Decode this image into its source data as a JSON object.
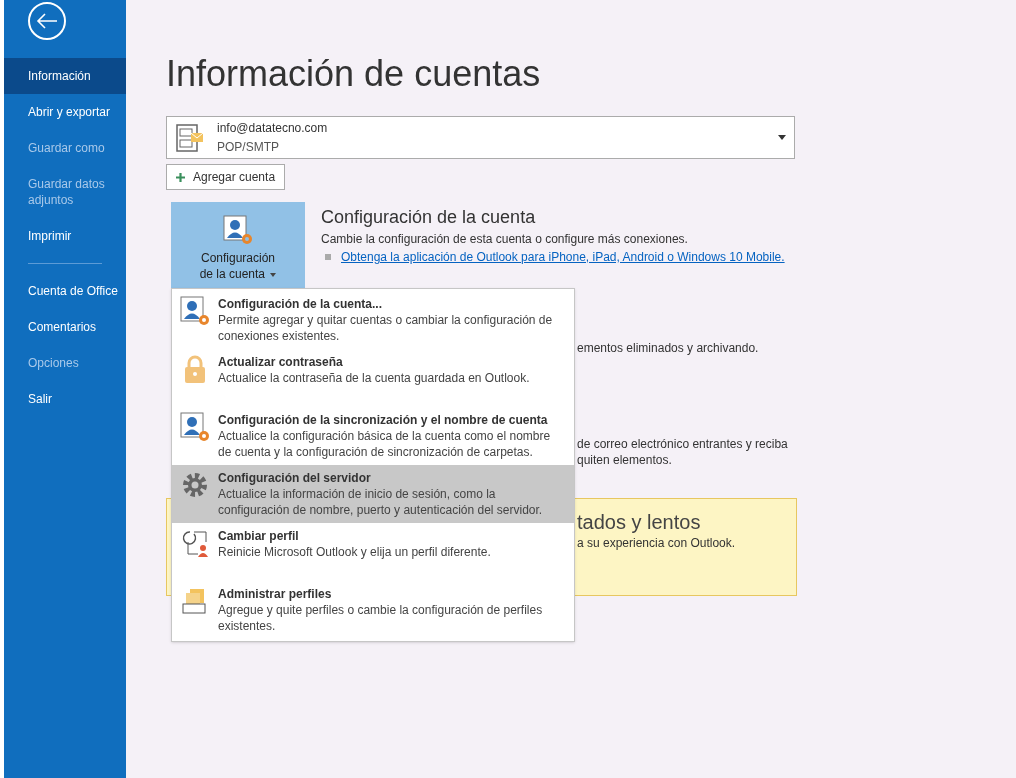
{
  "sidebar": {
    "items": [
      {
        "label": "Información",
        "selected": true,
        "disabled": false,
        "separator_after": false
      },
      {
        "label": "Abrir y exportar",
        "selected": false,
        "disabled": false,
        "separator_after": false
      },
      {
        "label": "Guardar como",
        "selected": false,
        "disabled": true,
        "separator_after": false
      },
      {
        "label": "Guardar datos adjuntos",
        "selected": false,
        "disabled": true,
        "separator_after": false
      },
      {
        "label": "Imprimir",
        "selected": false,
        "disabled": false,
        "separator_after": true
      },
      {
        "label": "Cuenta de Office",
        "selected": false,
        "disabled": false,
        "separator_after": false
      },
      {
        "label": "Comentarios",
        "selected": false,
        "disabled": false,
        "separator_after": false
      },
      {
        "label": "Opciones",
        "selected": false,
        "disabled": true,
        "separator_after": false
      },
      {
        "label": "Salir",
        "selected": false,
        "disabled": false,
        "separator_after": false
      }
    ]
  },
  "page_title": "Información de cuentas",
  "account": {
    "email": "info@datatecno.com",
    "type": "POP/SMTP"
  },
  "add_account_button": "Agregar cuenta",
  "account_settings": {
    "button_label": "Configuración de la cuenta",
    "title": "Configuración de la cuenta",
    "description": "Cambie la configuración de esta cuenta o configure más conexiones.",
    "link": "Obtenga la aplicación de Outlook para iPhone, iPad, Android o Windows 10 Mobile."
  },
  "hidden_sections": [
    {
      "kind": "plain",
      "lines": [
        "ementos eliminados y archivando."
      ]
    },
    {
      "kind": "plain",
      "lines": [
        "de correo electrónico entrantes y reciba",
        "quiten elementos."
      ]
    },
    {
      "kind": "warning",
      "title": "tados y lentos",
      "lines": [
        "a su experiencia con Outlook."
      ]
    }
  ],
  "menu": {
    "items": [
      {
        "kind": "account",
        "title": "Configuración de la cuenta...",
        "description": "Permite agregar y quitar cuentas o cambiar la configuración de conexiones existentes.",
        "selected": false
      },
      {
        "kind": "lock",
        "title": "Actualizar contraseña",
        "description": "Actualice la contraseña de la cuenta guardada en Outlook.",
        "selected": false
      },
      {
        "kind": "account",
        "title": "Configuración de la sincronización y el nombre de cuenta",
        "description": "Actualice la configuración básica de la cuenta como el nombre de cuenta y la configuración de sincronización de carpetas.",
        "selected": false
      },
      {
        "kind": "gear",
        "title": "Configuración del servidor",
        "description": "Actualice la información de inicio de sesión, como la configuración de nombre, puerto y autenticación del servidor.",
        "selected": true
      },
      {
        "kind": "profile",
        "title": "Cambiar perfil",
        "description": "Reinicie Microsoft Outlook y elija un perfil diferente.",
        "selected": false
      },
      {
        "kind": "profiles",
        "title": "Administrar perfiles",
        "description": "Agregue y quite perfiles o cambie la configuración de perfiles existentes.",
        "selected": false
      }
    ]
  }
}
